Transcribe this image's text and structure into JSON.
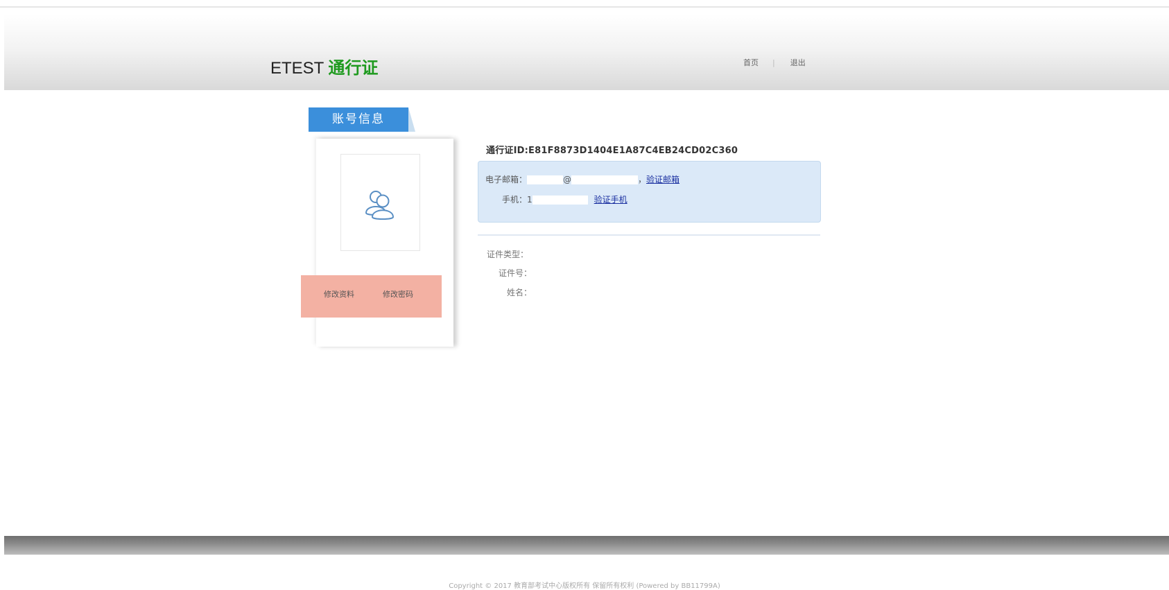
{
  "header": {
    "logo_brand": "ETEST",
    "logo_accent": "通行证",
    "nav_home": "首页",
    "nav_separator": "|",
    "nav_logout": "退出"
  },
  "tab": {
    "label": "账号信息"
  },
  "sidebar": {
    "avatar_icon": "user-group-icon",
    "edit_profile": "修改资料",
    "change_password": "修改密码"
  },
  "account": {
    "pass_id": "通行证ID:E81F8873D1404E1A87C4EB24CD02C360",
    "email_label": "电子邮箱：",
    "email_at": "@",
    "email_comma": "，",
    "verify_email": "验证邮箱",
    "phone_label": "手机：",
    "phone_prefix": "1",
    "verify_phone": "验证手机",
    "id_type_label": "证件类型：",
    "id_number_label": "证件号：",
    "name_label": "姓名："
  },
  "footer": {
    "copyright": "Copyright © 2017 教育部考试中心版权所有 保留所有权利 (Powered by BB11799A)"
  },
  "colors": {
    "accent_green": "#1f9a1f",
    "tab_blue": "#3b8fdb",
    "info_bg": "#dbe9f8",
    "action_bg": "#f3b1a3",
    "link_blue": "#1a2fa0"
  }
}
